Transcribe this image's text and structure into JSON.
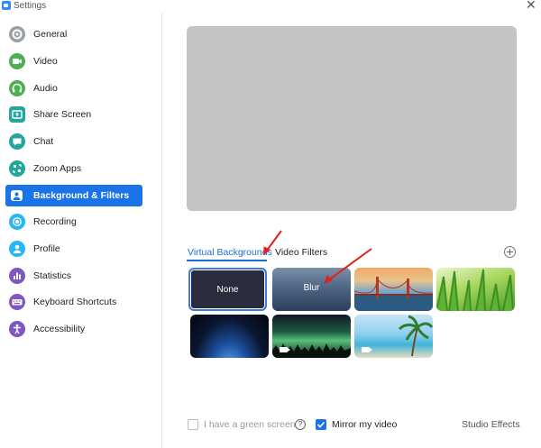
{
  "window": {
    "title": "Settings",
    "close_glyph": "✕"
  },
  "sidebar": {
    "items": [
      {
        "label": "General",
        "icon": "gear-icon",
        "color": "#9aa0a6"
      },
      {
        "label": "Video",
        "icon": "video-camera-icon",
        "color": "#4caf50"
      },
      {
        "label": "Audio",
        "icon": "headphones-icon",
        "color": "#4caf50"
      },
      {
        "label": "Share Screen",
        "icon": "share-screen-icon",
        "color": "#26a69a"
      },
      {
        "label": "Chat",
        "icon": "chat-bubble-icon",
        "color": "#26a69a"
      },
      {
        "label": "Zoom Apps",
        "icon": "apps-icon",
        "color": "#26a69a"
      },
      {
        "label": "Background & Filters",
        "icon": "person-background-icon",
        "color": "#1a73e8",
        "active": true
      },
      {
        "label": "Recording",
        "icon": "record-icon",
        "color": "#29b6f6"
      },
      {
        "label": "Profile",
        "icon": "profile-icon",
        "color": "#29b6f6"
      },
      {
        "label": "Statistics",
        "icon": "statistics-icon",
        "color": "#7e57c2"
      },
      {
        "label": "Keyboard Shortcuts",
        "icon": "keyboard-icon",
        "color": "#7e57c2"
      },
      {
        "label": "Accessibility",
        "icon": "accessibility-icon",
        "color": "#7e57c2"
      }
    ]
  },
  "tabs": {
    "virtual_backgrounds": "Virtual Backgrounds",
    "video_filters": "Video Filters"
  },
  "backgrounds": [
    {
      "label": "None",
      "selected": true
    },
    {
      "label": "Blur"
    },
    {
      "label": "",
      "image": "golden-gate-bridge"
    },
    {
      "label": "",
      "image": "grass"
    },
    {
      "label": "",
      "image": "earth-from-space"
    },
    {
      "label": "",
      "image": "aurora",
      "video": true
    },
    {
      "label": "",
      "image": "beach-palm",
      "video": true
    }
  ],
  "footer": {
    "green_screen_label": "I have a green screen",
    "green_screen_checked": false,
    "help_glyph": "?",
    "mirror_label": "Mirror my video",
    "mirror_checked": true,
    "studio_effects_label": "Studio Effects"
  },
  "accent_color": "#1a73e8",
  "annotation_color": "#e0201c"
}
